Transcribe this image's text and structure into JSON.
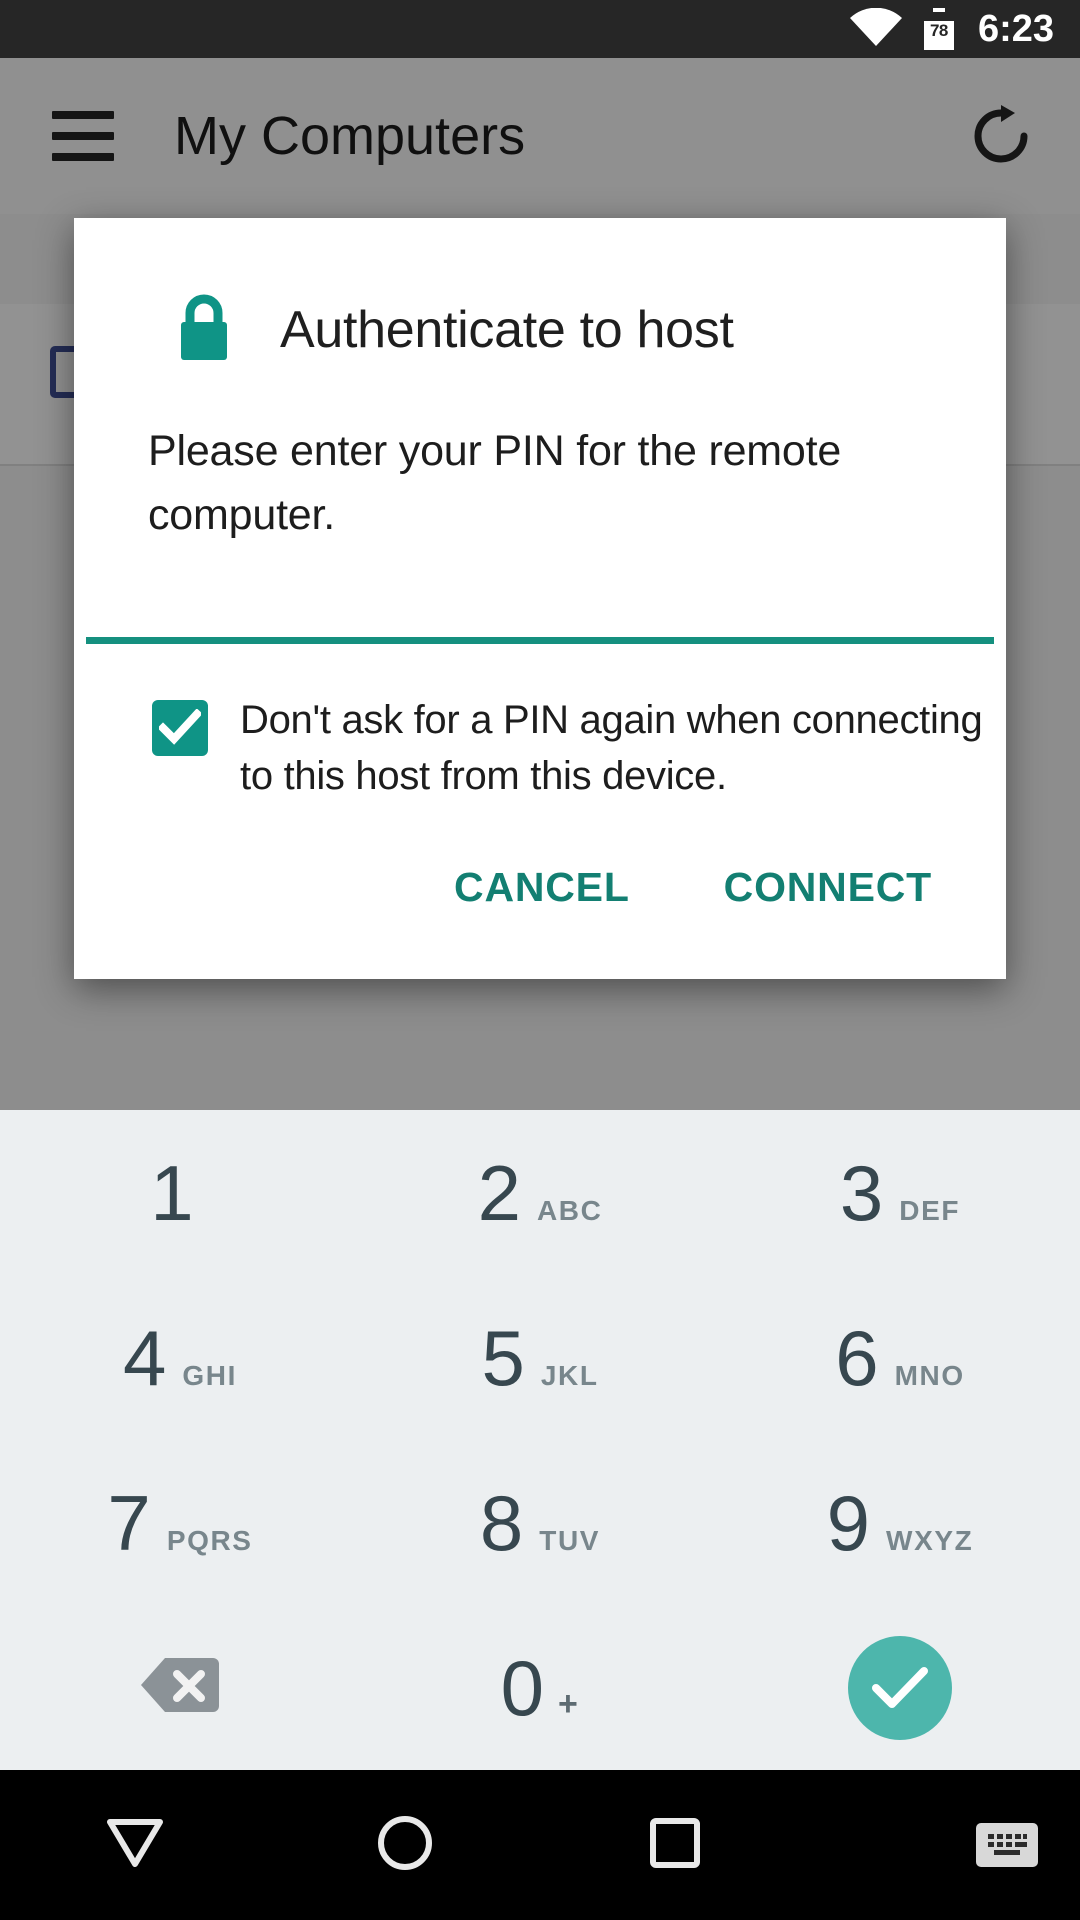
{
  "status_bar": {
    "wifi_icon": "wifi-icon",
    "battery_icon": "battery-icon",
    "battery_level": "78",
    "time": "6:23"
  },
  "app": {
    "menu_icon": "hamburger-menu-icon",
    "title": "My Computers",
    "refresh_icon": "refresh-icon",
    "computer_icon": "computer-monitor-icon"
  },
  "dialog": {
    "lock_icon": "lock-icon",
    "title": "Authenticate to host",
    "message": "Please enter your PIN for the remote computer.",
    "checkbox": {
      "checked": true,
      "check_icon": "checkmark-icon",
      "label": "Don't ask for a PIN again when connecting to this host from this device."
    },
    "cancel_label": "CANCEL",
    "connect_label": "CONNECT",
    "accent_color": "#0f9486",
    "divider_color": "#15907f",
    "action_color": "#137f72"
  },
  "keypad": {
    "rows": [
      [
        {
          "digit": "1",
          "letters": "",
          "name": "key-1"
        },
        {
          "digit": "2",
          "letters": "ABC",
          "name": "key-2"
        },
        {
          "digit": "3",
          "letters": "DEF",
          "name": "key-3"
        }
      ],
      [
        {
          "digit": "4",
          "letters": "GHI",
          "name": "key-4"
        },
        {
          "digit": "5",
          "letters": "JKL",
          "name": "key-5"
        },
        {
          "digit": "6",
          "letters": "MNO",
          "name": "key-6"
        }
      ],
      [
        {
          "digit": "7",
          "letters": "PQRS",
          "name": "key-7"
        },
        {
          "digit": "8",
          "letters": "TUV",
          "name": "key-8"
        },
        {
          "digit": "9",
          "letters": "WXYZ",
          "name": "key-9"
        }
      ]
    ],
    "backspace_icon": "backspace-icon",
    "zero": {
      "digit": "0",
      "letters": "+",
      "name": "key-0"
    },
    "enter_icon": "checkmark-enter-icon",
    "enter_color": "#4db6ac",
    "background_color": "#eceff1",
    "digit_color": "#37474f"
  },
  "nav_bar": {
    "back_icon": "back-triangle-icon",
    "home_icon": "home-circle-icon",
    "recents_icon": "recents-square-icon",
    "keyboard_icon": "keyboard-icon"
  }
}
